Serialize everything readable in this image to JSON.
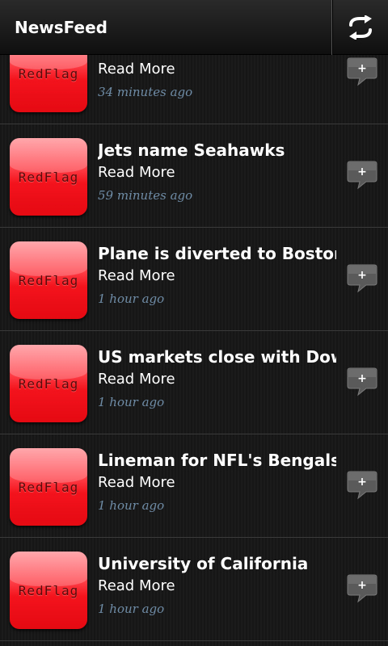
{
  "header": {
    "title": "NewsFeed",
    "refresh_icon": "refresh-icon"
  },
  "items": [
    {
      "thumb_text": "RedFlag",
      "headline": "",
      "read_more": "Read More",
      "time": "34 minutes ago"
    },
    {
      "thumb_text": "RedFlag",
      "headline": "Jets name Seahawks",
      "read_more": "Read More",
      "time": "59 minutes ago"
    },
    {
      "thumb_text": "RedFlag",
      "headline": "Plane is diverted to Boston's",
      "read_more": "Read More",
      "time": "1 hour ago"
    },
    {
      "thumb_text": "RedFlag",
      "headline": "US markets close with Dow,",
      "read_more": "Read More",
      "time": "1 hour ago"
    },
    {
      "thumb_text": "RedFlag",
      "headline": "Lineman for NFL's Bengals",
      "read_more": "Read More",
      "time": "1 hour ago"
    },
    {
      "thumb_text": "RedFlag",
      "headline": "University of California",
      "read_more": "Read More",
      "time": "1 hour ago"
    }
  ],
  "add_button_label": "+",
  "colors": {
    "timestamp": "#6f8ca6",
    "thumbnail_red": "#f3131c",
    "text": "#ffffff"
  }
}
